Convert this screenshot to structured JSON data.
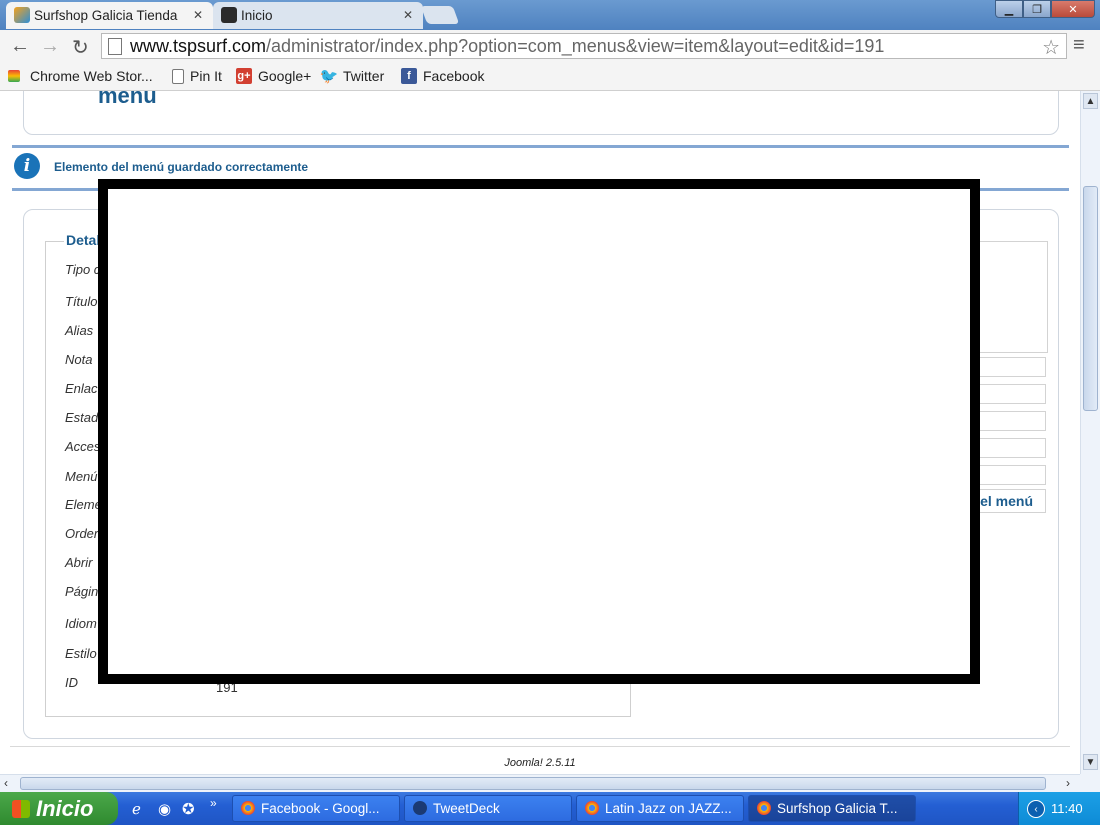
{
  "browser": {
    "tabs": [
      {
        "title": "Surfshop Galicia Tienda",
        "active": true
      },
      {
        "title": "Inicio",
        "active": false
      }
    ],
    "url_host": "www.tspsurf.com",
    "url_path": "/administrator/index.php?option=com_menus&view=item&layout=edit&id=191",
    "bookmarks": [
      "Chrome Web Stor...",
      "Pin It",
      "Google+",
      "Twitter",
      "Facebook"
    ]
  },
  "page": {
    "header_title": "menu",
    "message": "Elemento del menú guardado correctamente",
    "fieldset_legend": "Detal",
    "labels": [
      "Tipo c",
      "Título",
      "Alias",
      "Nota",
      "Enlac",
      "Estad",
      "Acces",
      "Menú",
      "Eleme",
      "Order",
      "Abrir",
      "Págin",
      "Idiom",
      "Estilo",
      "ID"
    ],
    "id_value": "191",
    "right_button_text": "el menú",
    "footer": "Joomla! 2.5.11"
  },
  "taskbar": {
    "start_label": "Inicio",
    "tasks": [
      "Facebook - Googl...",
      "TweetDeck",
      "Latin Jazz on JAZZ...",
      "Surfshop Galicia T..."
    ],
    "clock": "11:40"
  }
}
